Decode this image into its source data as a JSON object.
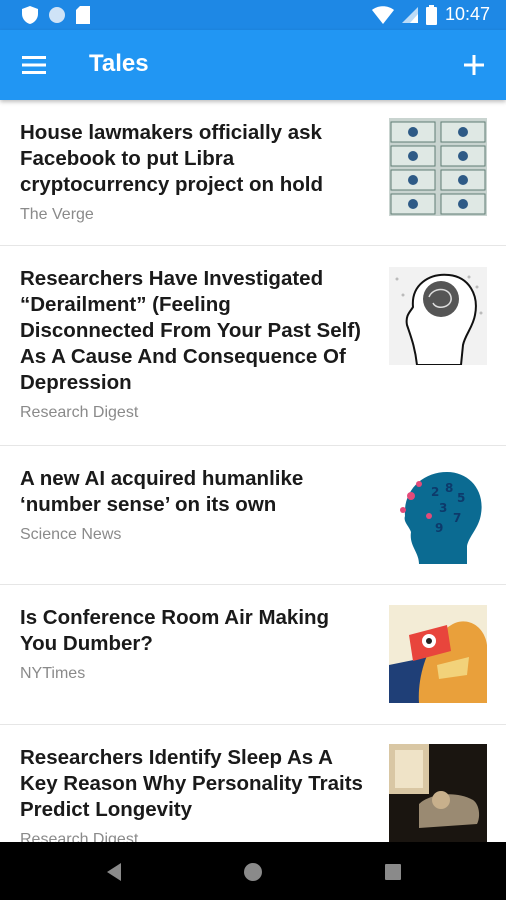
{
  "status_bar": {
    "time": "10:47",
    "icons": [
      "shield-icon",
      "circle-icon",
      "sd-card-icon",
      "wifi-icon",
      "signal-icon",
      "battery-icon"
    ]
  },
  "app_bar": {
    "title": "Tales",
    "icons": [
      "menu-icon",
      "add-icon"
    ],
    "color": "#2196f3"
  },
  "articles": [
    {
      "headline": "House lawmakers officially ask Facebook to put Libra cryptocurrency project on hold",
      "source": "The Verge"
    },
    {
      "headline": "Researchers Have Investigated “Derailment” (Feeling Disconnected From Your Past Self) As A Cause And Consequence Of Depression",
      "source": "Research Digest"
    },
    {
      "headline": "A new AI acquired humanlike ‘number sense’ on its own",
      "source": "Science News"
    },
    {
      "headline": "Is Conference Room Air Making You Dumber?",
      "source": "NYTimes"
    },
    {
      "headline": "Researchers Identify Sleep As A Key Reason Why Personality Traits Predict Longevity",
      "source": "Research Digest"
    }
  ],
  "nav_bar": {
    "icons": [
      "back-icon",
      "home-icon",
      "recents-icon"
    ]
  }
}
